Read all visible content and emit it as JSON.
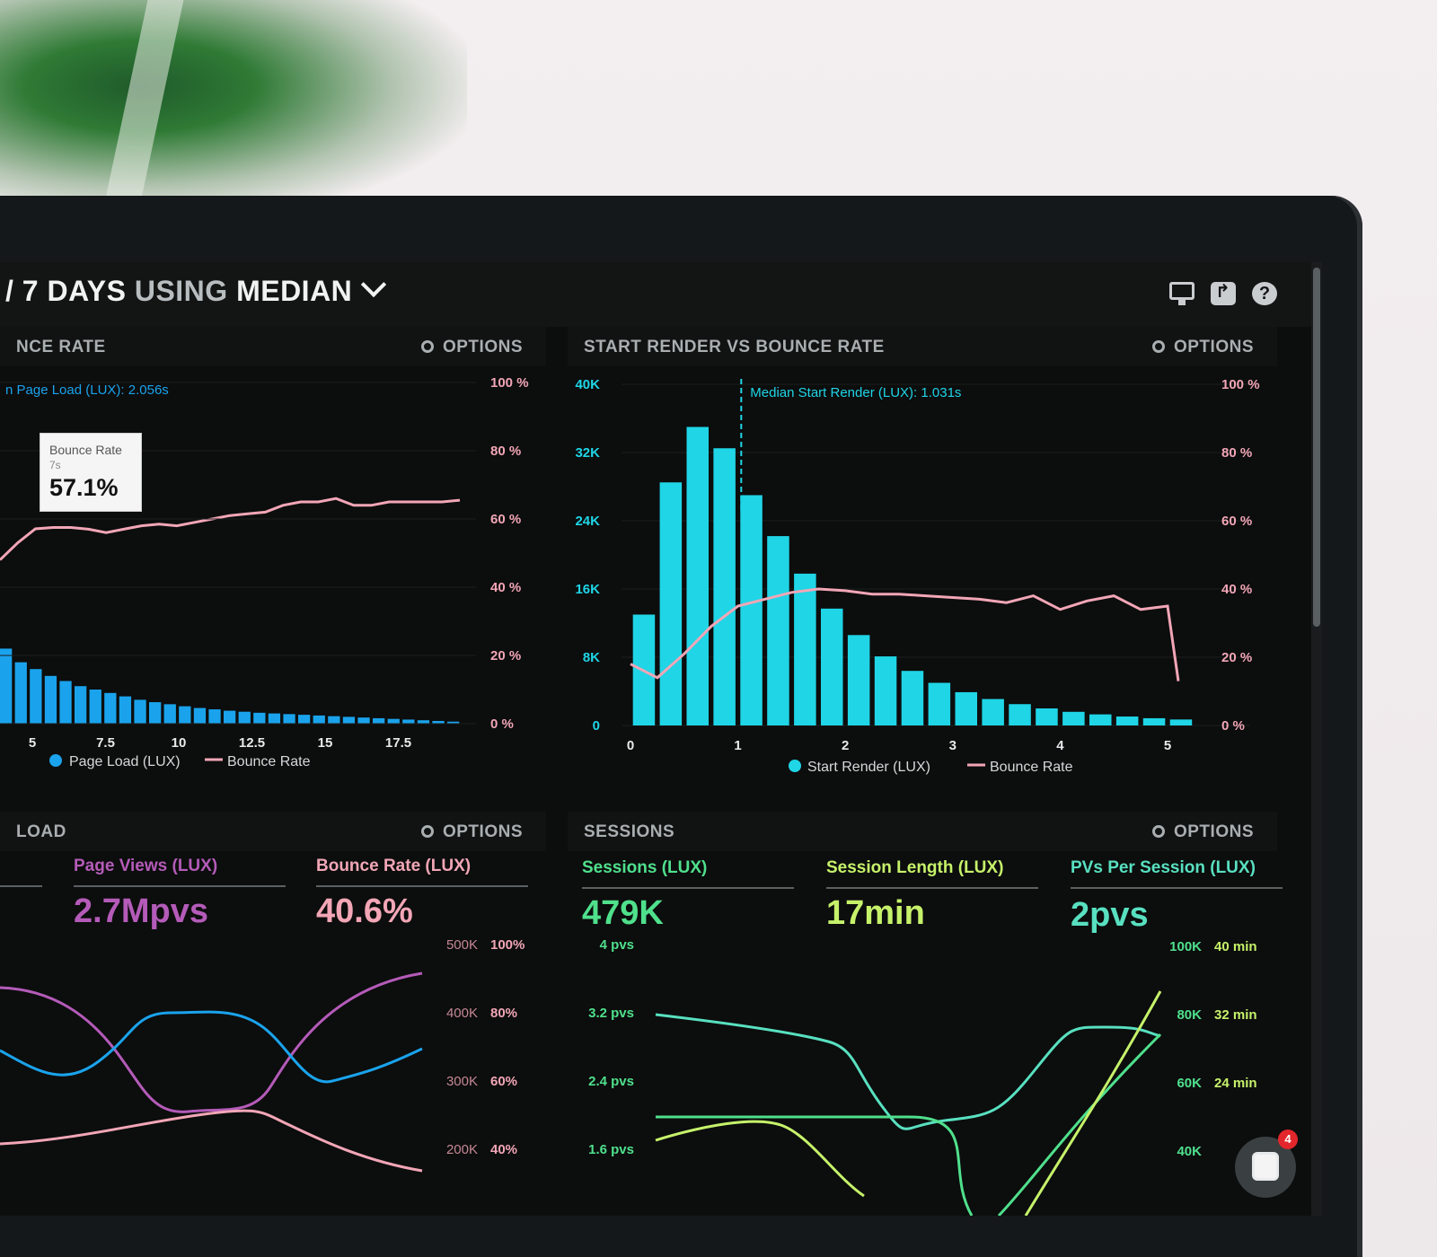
{
  "header": {
    "title_prefix": "/ 7 DAYS ",
    "title_muted": "USING ",
    "title_suffix": "MEDIAN"
  },
  "top_icons": [
    "monitor-icon",
    "share-icon",
    "help-icon"
  ],
  "panels": {
    "bounce": {
      "title": "NCE RATE",
      "options": "OPTIONS",
      "annotation": "n Page Load (LUX): 2.056s",
      "tooltip": {
        "label": "Bounce Rate",
        "sub": "7s",
        "value": "57.1%"
      },
      "legend": [
        "Page Load (LUX)",
        "Bounce Rate"
      ],
      "x_ticks": [
        "5",
        "7.5",
        "10",
        "12.5",
        "15",
        "17.5"
      ],
      "y_right_ticks": [
        "100 %",
        "80 %",
        "60 %",
        "40 %",
        "20 %",
        "0 %"
      ]
    },
    "start_render": {
      "title": "START RENDER VS BOUNCE RATE",
      "options": "OPTIONS",
      "annotation": "Median Start Render (LUX): 1.031s",
      "legend": [
        "Start Render (LUX)",
        "Bounce Rate"
      ],
      "x_ticks": [
        "0",
        "1",
        "2",
        "3",
        "4",
        "5"
      ],
      "y_left_ticks": [
        "40K",
        "32K",
        "24K",
        "16K",
        "8K",
        "0"
      ],
      "y_right_ticks": [
        "100 %",
        "80 %",
        "60 %",
        "40 %",
        "20 %",
        "0 %"
      ]
    },
    "load": {
      "title": "LOAD",
      "options": "OPTIONS",
      "kpis": [
        {
          "label": "Page Views (LUX)",
          "value": "2.7Mpvs"
        },
        {
          "label": "Bounce Rate (LUX)",
          "value": "40.6%"
        }
      ],
      "y_mid_ticks": [
        "500K",
        "400K",
        "300K",
        "200K"
      ],
      "y_right_ticks": [
        "100%",
        "80%",
        "60%",
        "40%"
      ]
    },
    "sessions": {
      "title": "SESSIONS",
      "options": "OPTIONS",
      "kpis": [
        {
          "label": "Sessions (LUX)",
          "value": "479K"
        },
        {
          "label": "Session Length (LUX)",
          "value": "17min"
        },
        {
          "label": "PVs Per Session (LUX)",
          "value": "2pvs"
        }
      ],
      "y_left_ticks": [
        "4 pvs",
        "3.2 pvs",
        "2.4 pvs",
        "1.6 pvs"
      ],
      "y_mid_ticks": [
        "100K",
        "80K",
        "60K",
        "40K"
      ],
      "y_right_ticks": [
        "40 min",
        "32 min",
        "24 min"
      ]
    }
  },
  "chat": {
    "badge": "4"
  },
  "colors": {
    "cyan": "#1fd5e6",
    "blue": "#1aa3ec",
    "pink": "#f2a6b6",
    "magenta": "#b45bb9",
    "green": "#4fe08c",
    "lime": "#c6f26a",
    "teal": "#58e0c0"
  },
  "chart_data": [
    {
      "type": "bar",
      "title": "START RENDER VS BOUNCE RATE",
      "xlabel": "",
      "ylabel": "",
      "ylim": [
        0,
        40000
      ],
      "y2lim": [
        0,
        100
      ],
      "x": [
        0.125,
        0.375,
        0.625,
        0.875,
        1.125,
        1.375,
        1.625,
        1.875,
        2.125,
        2.375,
        2.625,
        2.875,
        3.125,
        3.375,
        3.625,
        3.875,
        4.125,
        4.375,
        4.625,
        4.875,
        5.125
      ],
      "series": [
        {
          "name": "Start Render (LUX)",
          "values": [
            13000,
            28500,
            35000,
            32500,
            27000,
            22200,
            17800,
            13700,
            10600,
            8100,
            6400,
            5000,
            3900,
            3100,
            2500,
            2000,
            1600,
            1300,
            1050,
            850,
            700
          ]
        },
        {
          "name": "Bounce Rate",
          "type": "line",
          "axis": "right",
          "x": [
            0,
            0.25,
            0.5,
            0.75,
            1.0,
            1.25,
            1.5,
            1.75,
            2.0,
            2.25,
            2.5,
            2.75,
            3.0,
            3.25,
            3.5,
            3.75,
            4.0,
            4.25,
            4.5,
            4.75,
            5.0,
            5.1
          ],
          "values": [
            18,
            14,
            21,
            29,
            35,
            37,
            39,
            40,
            39.5,
            38.5,
            38.5,
            38,
            37.5,
            37,
            36,
            38,
            34,
            36.5,
            38,
            34,
            35,
            13
          ]
        }
      ],
      "y2_ticks": [
        "100 %",
        "80 %",
        "60 %",
        "40 %",
        "20 %",
        "0 %"
      ]
    },
    {
      "type": "bar",
      "title": "NCE RATE",
      "x_ticks": [
        "5",
        "7.5",
        "10",
        "12.5",
        "15",
        "17.5"
      ],
      "series": [
        {
          "name": "Page Load (LUX)",
          "values": [
            22,
            18,
            16,
            14,
            12.5,
            11,
            10,
            9,
            8,
            7,
            6.3,
            5.7,
            5.1,
            4.6,
            4.2,
            3.8,
            3.5,
            3.2,
            3,
            2.8,
            2.6,
            2.4,
            2.2,
            2,
            1.8,
            1.6,
            1.4,
            1.2,
            1,
            0.8,
            0.6
          ]
        },
        {
          "name": "Bounce Rate",
          "type": "line",
          "axis": "right",
          "values": [
            48,
            53,
            57.1,
            57.5,
            57.5,
            57,
            56,
            57,
            58,
            58.5,
            58,
            59,
            60,
            61,
            61.5,
            62,
            64,
            65,
            65,
            66,
            64,
            64,
            65,
            65,
            65,
            65,
            65.5
          ]
        }
      ],
      "y2_ticks": [
        "100 %",
        "80 %",
        "60 %",
        "40 %",
        "20 %",
        "0 %"
      ]
    }
  ]
}
